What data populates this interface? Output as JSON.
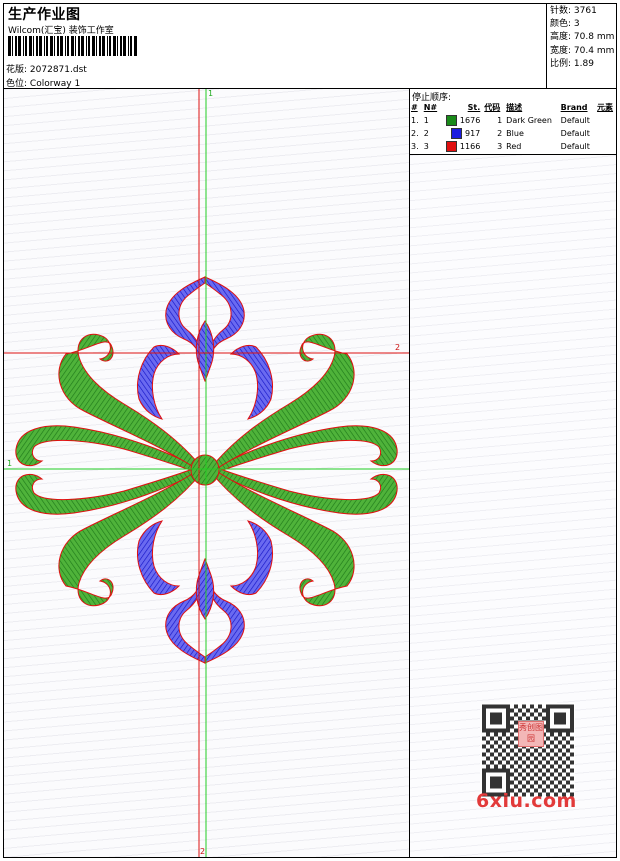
{
  "header": {
    "title": "生产作业图",
    "company": "Wilcom(汇宝) 装饰工作室",
    "file_label": "花版:",
    "file_name": "2072871.dst",
    "colorway_label": "色位:",
    "colorway": "Colorway 1"
  },
  "stats": {
    "stitches_label": "针数:",
    "stitches": "3761",
    "colors_label": "颜色:",
    "colors": "3",
    "height_label": "高度:",
    "height": "70.8 mm",
    "width_label": "宽度:",
    "width": "70.4 mm",
    "scale_label": "比例:",
    "scale": "1.89"
  },
  "stop_sequence": {
    "title": "停止顺序:",
    "headers": [
      "#",
      "N#",
      "St.",
      "代码",
      "描述",
      "Brand",
      "元素"
    ],
    "rows": [
      {
        "idx": "1.",
        "n": "1",
        "color": "#1a8a1a",
        "st": "1676",
        "code": "1",
        "desc": "Dark Green",
        "brand": "Default"
      },
      {
        "idx": "2.",
        "n": "2",
        "color": "#1c1ce0",
        "st": "917",
        "code": "2",
        "desc": "Blue",
        "brand": "Default"
      },
      {
        "idx": "3.",
        "n": "3",
        "color": "#e01010",
        "st": "1166",
        "code": "3",
        "desc": "Red",
        "brand": "Default"
      }
    ]
  },
  "design": {
    "axis_labels": {
      "top": "1",
      "right": "2",
      "left": "1",
      "bottom": "2"
    },
    "colors": {
      "green": "#3c9e2a",
      "blue": "#2a2ae6",
      "red": "#e01010",
      "axis_green": "#22cc22",
      "axis_red": "#dd1111"
    }
  },
  "watermark": {
    "text": "6xiu.com",
    "seal": "秀创图园"
  }
}
